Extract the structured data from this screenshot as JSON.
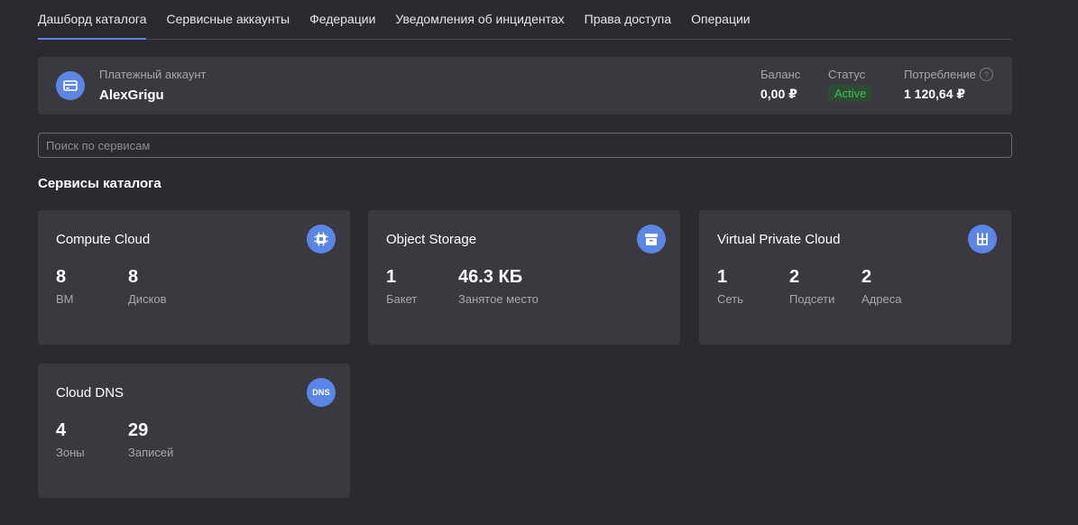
{
  "tabs": [
    {
      "label": "Дашборд каталога"
    },
    {
      "label": "Сервисные аккаунты"
    },
    {
      "label": "Федерации"
    },
    {
      "label": "Уведомления об инцидентах"
    },
    {
      "label": "Права доступа"
    },
    {
      "label": "Операции"
    }
  ],
  "billing": {
    "icon": "credit-card-icon",
    "label": "Платежный аккаунт",
    "name": "AlexGrigu",
    "balance_label": "Баланс",
    "balance_value": "0,00 ₽",
    "status_label": "Статус",
    "status_value": "Active",
    "consumption_label": "Потребление",
    "consumption_value": "1 120,64 ₽"
  },
  "search": {
    "placeholder": "Поиск по сервисам"
  },
  "section_title": "Сервисы каталога",
  "services": [
    {
      "title": "Compute Cloud",
      "icon": "chip-icon",
      "metrics": [
        {
          "value": "8",
          "label": "ВМ"
        },
        {
          "value": "8",
          "label": "Дисков"
        }
      ]
    },
    {
      "title": "Object Storage",
      "icon": "storage-box-icon",
      "metrics": [
        {
          "value": "1",
          "label": "Бакет"
        },
        {
          "value": "46.3 КБ",
          "label": "Занятое место"
        }
      ]
    },
    {
      "title": "Virtual Private Cloud",
      "icon": "network-icon",
      "metrics": [
        {
          "value": "1",
          "label": "Сеть"
        },
        {
          "value": "2",
          "label": "Подсети"
        },
        {
          "value": "2",
          "label": "Адреса"
        }
      ]
    },
    {
      "title": "Cloud DNS",
      "icon": "dns-icon",
      "icon_text": "DNS",
      "metrics": [
        {
          "value": "4",
          "label": "Зоны"
        },
        {
          "value": "29",
          "label": "Записей"
        }
      ]
    }
  ],
  "colors": {
    "background": "#2b2a30",
    "card": "#3a3940",
    "accent": "#5b86e5",
    "active_status": "#3fbf5a"
  }
}
